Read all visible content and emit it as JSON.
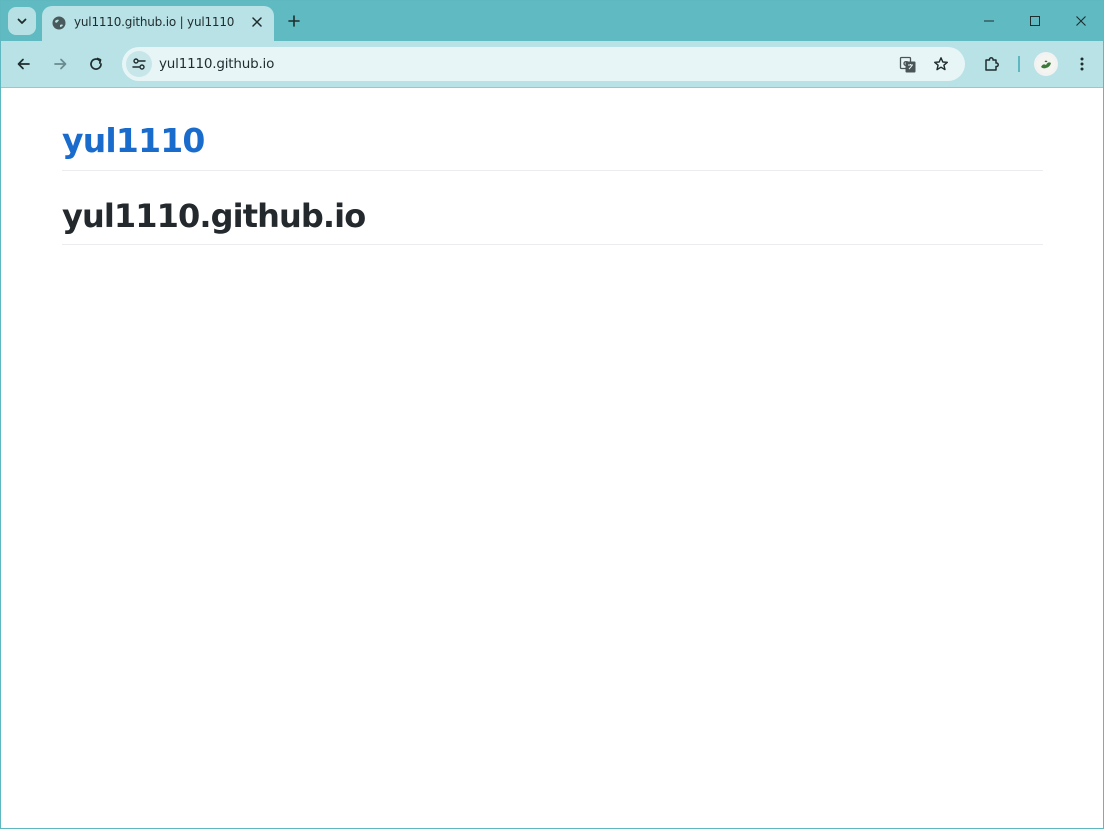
{
  "browser": {
    "tab": {
      "title": "yul1110.github.io | yul1110",
      "favicon": "globe-icon"
    },
    "omnibox": {
      "url": "yul1110.github.io"
    },
    "colors": {
      "frame": "#5fbac1",
      "toolbar": "#b8e2e6",
      "omnibox": "#e8f5f6"
    }
  },
  "page": {
    "site_title": "yul1110",
    "heading": "yul1110.github.io",
    "colors": {
      "link": "#1a6ccc",
      "heading": "#24292e"
    }
  }
}
